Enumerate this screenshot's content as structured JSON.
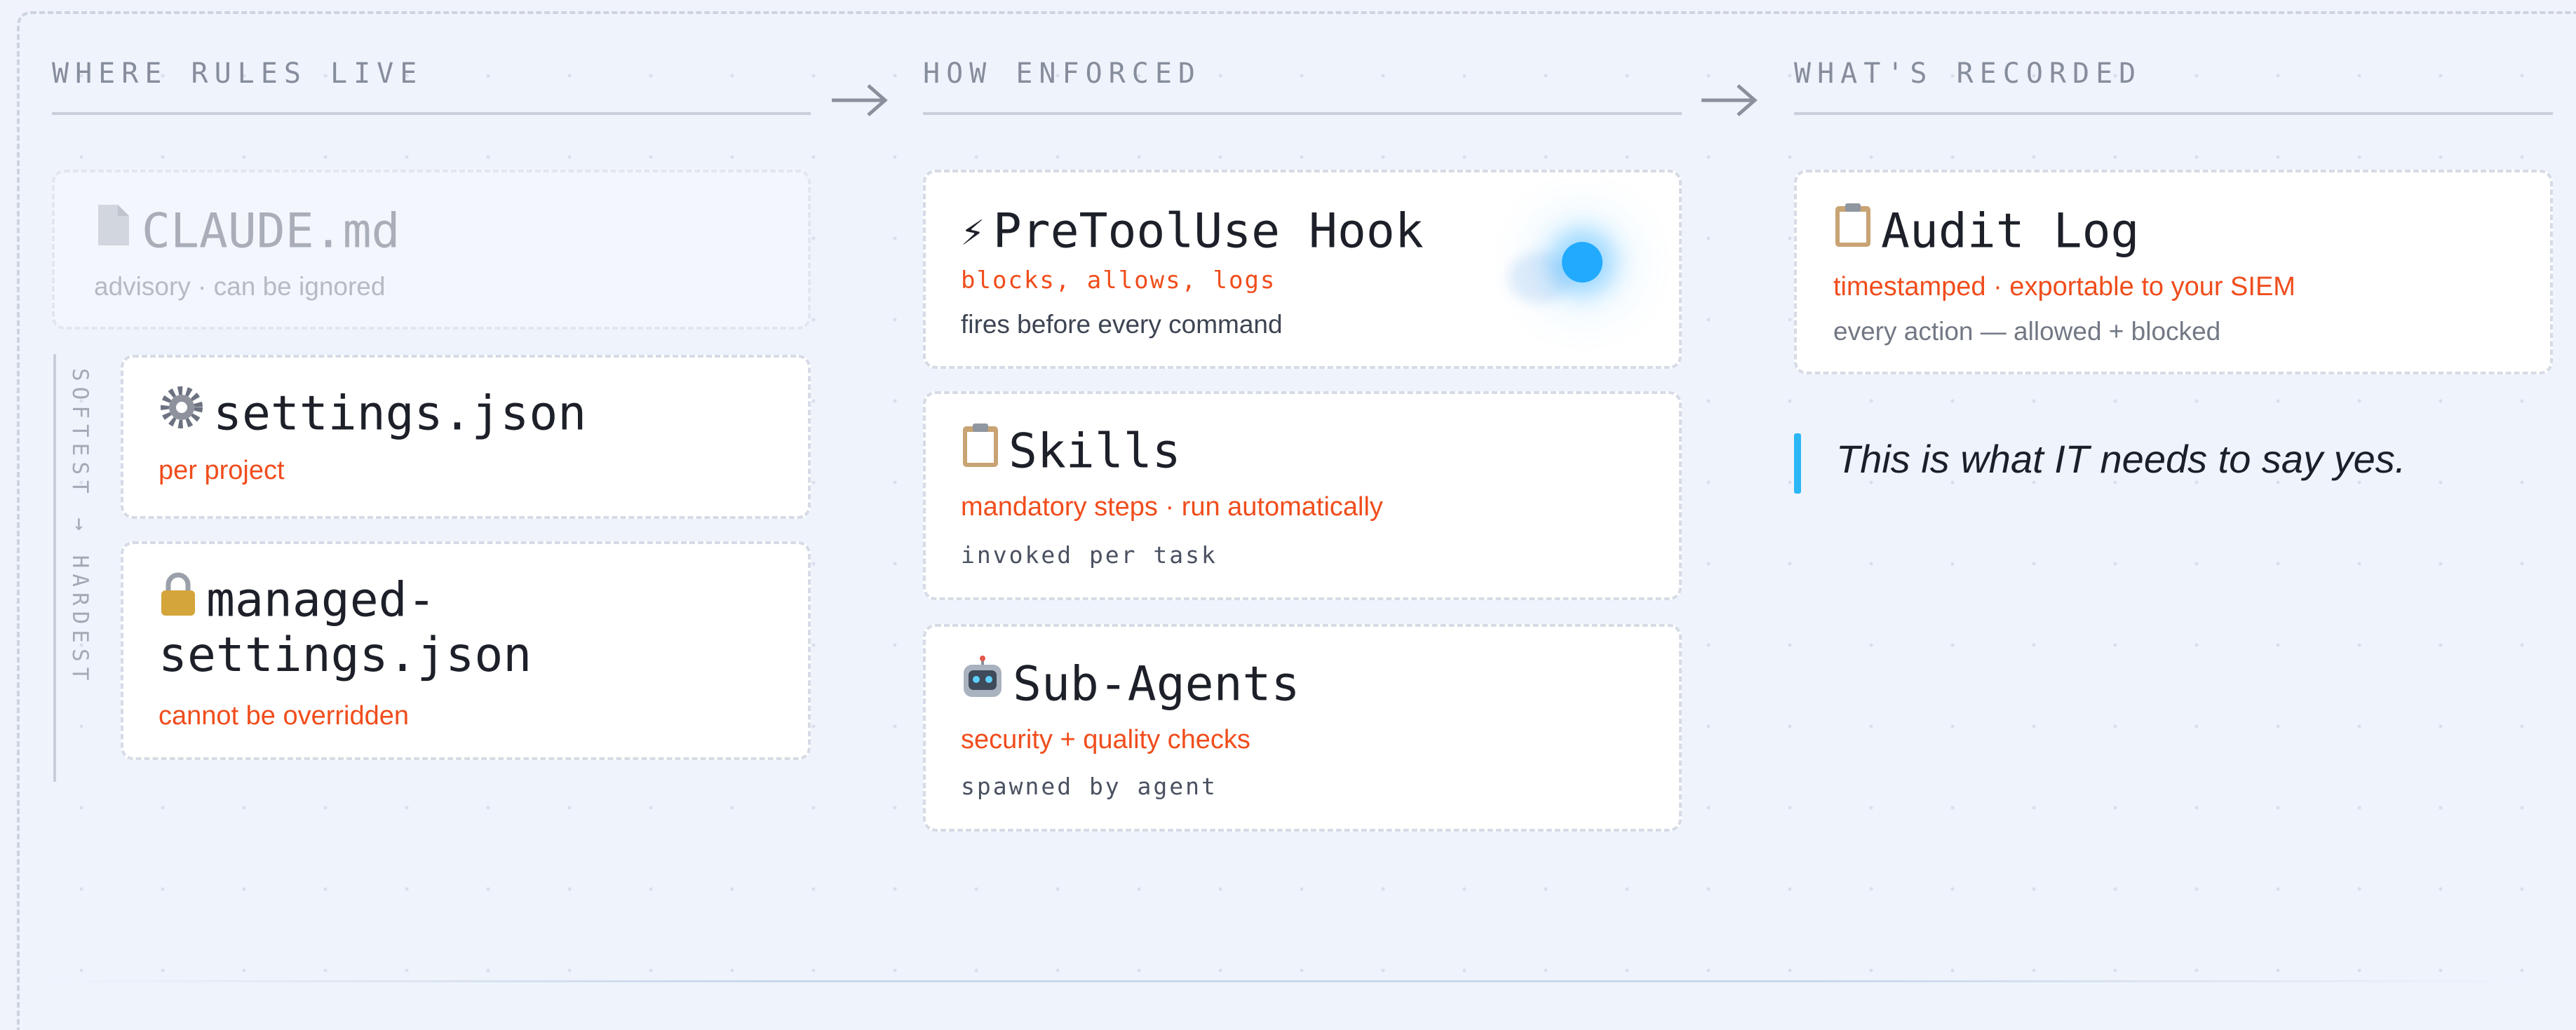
{
  "columns": {
    "where": {
      "header": "WHERE RULES LIVE"
    },
    "how": {
      "header": "HOW ENFORCED"
    },
    "what": {
      "header": "WHAT'S RECORDED"
    }
  },
  "sidebar": {
    "label": "SOFTEST → HARDEST"
  },
  "where_cards": [
    {
      "icon": "document-icon",
      "title": "CLAUDE.md",
      "tagline": "advisory · can be ignored"
    },
    {
      "icon": "gear-icon",
      "title": "settings.json",
      "tagline": "per project"
    },
    {
      "icon": "lock-icon",
      "title_line1": "managed-",
      "title_line2": "settings.json",
      "tagline": "cannot be overridden"
    }
  ],
  "how_cards": [
    {
      "icon": "lightning-icon",
      "icon_glyph": "⚡",
      "title": "PreToolUse Hook",
      "tagline": "blocks, allows, logs",
      "detail": "fires before every command"
    },
    {
      "icon": "clipboard-icon",
      "title": "Skills",
      "tagline": "mandatory steps · run automatically",
      "detail": "invoked per task"
    },
    {
      "icon": "robot-icon",
      "title": "Sub-Agents",
      "tagline": "security + quality checks",
      "detail": "spawned by agent"
    }
  ],
  "what_cards": [
    {
      "icon": "clipboard-icon",
      "title": "Audit Log",
      "tagline": "timestamped · exportable to your SIEM",
      "detail": "every action — allowed + blocked"
    }
  ],
  "quote": {
    "text": "This is what IT needs to say yes."
  },
  "colors": {
    "accent_orange": "#f04d1c",
    "accent_blue": "#22aaff",
    "background": "#eff3fc"
  }
}
